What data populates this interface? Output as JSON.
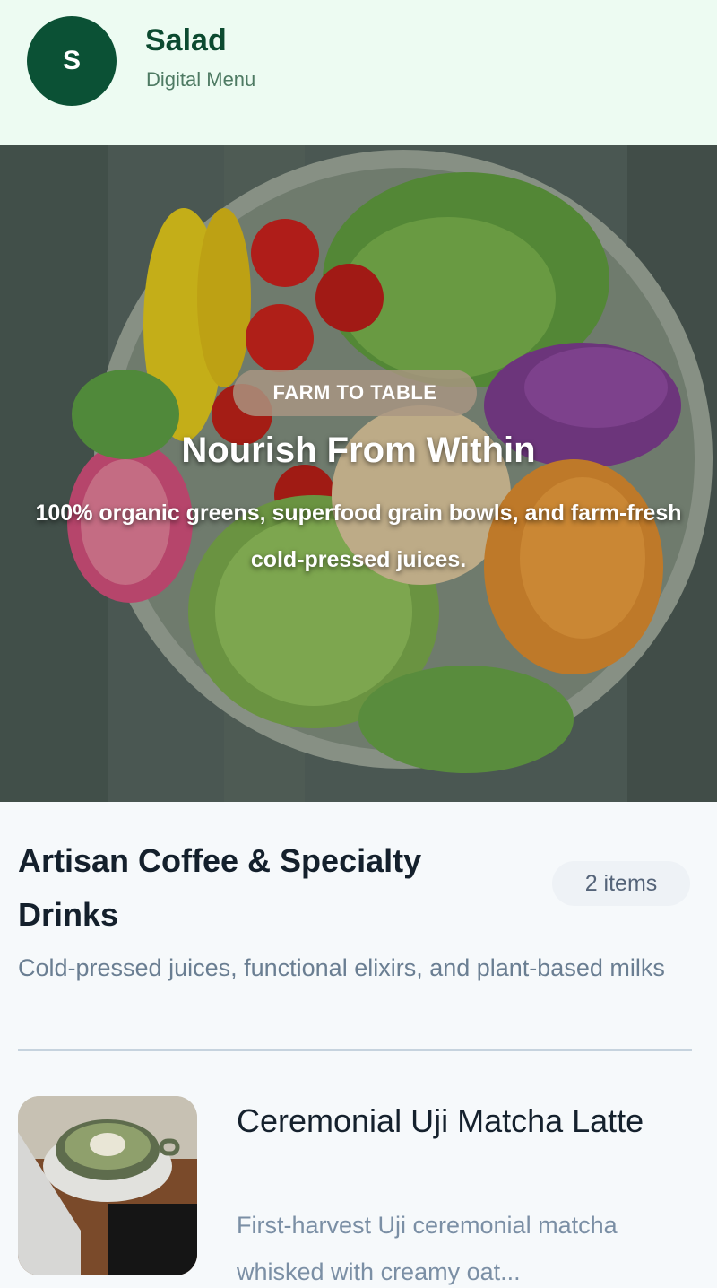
{
  "header": {
    "logo_letter": "S",
    "name": "Salad",
    "subtitle": "Digital Menu"
  },
  "hero": {
    "badge": "FARM TO TABLE",
    "title": "Nourish From Within",
    "description": "100% organic greens, superfood grain bowls, and farm-fresh cold-pressed juices."
  },
  "category": {
    "title": "Artisan Coffee & Specialty Drinks",
    "count": "2 items",
    "description": "Cold-pressed juices, functional elixirs, and plant-based milks"
  },
  "items": [
    {
      "name": "Ceremonial Uji Matcha Latte",
      "description": "First-harvest Uji ceremonial matcha whisked with creamy oat..."
    }
  ],
  "colors": {
    "brand": "#0b5135",
    "header_bg": "#edfbf2",
    "muted_text": "#6a7e92"
  }
}
